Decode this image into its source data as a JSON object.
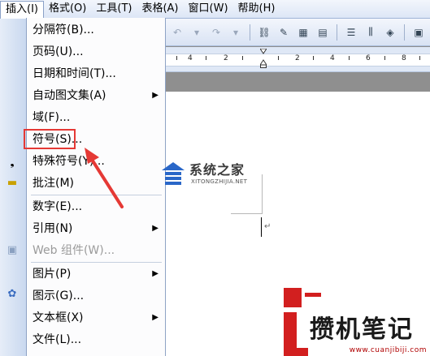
{
  "menubar": {
    "items": [
      "插入(I)",
      "格式(O)",
      "工具(T)",
      "表格(A)",
      "窗口(W)",
      "帮助(H)"
    ]
  },
  "insert_menu": {
    "items": [
      {
        "label": "分隔符(B)...",
        "submenu": false,
        "disabled": false
      },
      {
        "label": "页码(U)...",
        "submenu": false,
        "disabled": false
      },
      {
        "label": "日期和时间(T)...",
        "submenu": false,
        "disabled": false
      },
      {
        "label": "自动图文集(A)",
        "submenu": true,
        "disabled": false
      },
      {
        "label": "域(F)...",
        "submenu": false,
        "disabled": false
      },
      {
        "label": "符号(S)...",
        "submenu": false,
        "disabled": false
      },
      {
        "label": "特殊符号(Y)...",
        "submenu": false,
        "disabled": false
      },
      {
        "label": "批注(M)",
        "submenu": false,
        "disabled": false
      },
      {
        "label": "数字(E)...",
        "submenu": false,
        "disabled": false
      },
      {
        "label": "引用(N)",
        "submenu": true,
        "disabled": false
      },
      {
        "label": "Web 组件(W)...",
        "submenu": false,
        "disabled": true
      },
      {
        "label": "图片(P)",
        "submenu": true,
        "disabled": false
      },
      {
        "label": "图示(G)...",
        "submenu": false,
        "disabled": false
      },
      {
        "label": "文本框(X)",
        "submenu": true,
        "disabled": false
      },
      {
        "label": "文件(L)...",
        "submenu": false,
        "disabled": false
      }
    ],
    "submenu_arrow": "▶"
  },
  "ruler": {
    "labels": [
      "4",
      "2",
      "2",
      "4",
      "6",
      "8"
    ]
  },
  "watermarks": {
    "site1_title": "系统之家",
    "site1_sub": "XITONGZHIJIA.NET",
    "site2_title": "攒机笔记",
    "site2_url": "www.cuanjibiji.com"
  },
  "colors": {
    "highlight_box": "#e53935",
    "menubar_bg": "#dde6f6",
    "page_bg": "#ffffff",
    "workspace_bg": "#8f8f8f"
  }
}
